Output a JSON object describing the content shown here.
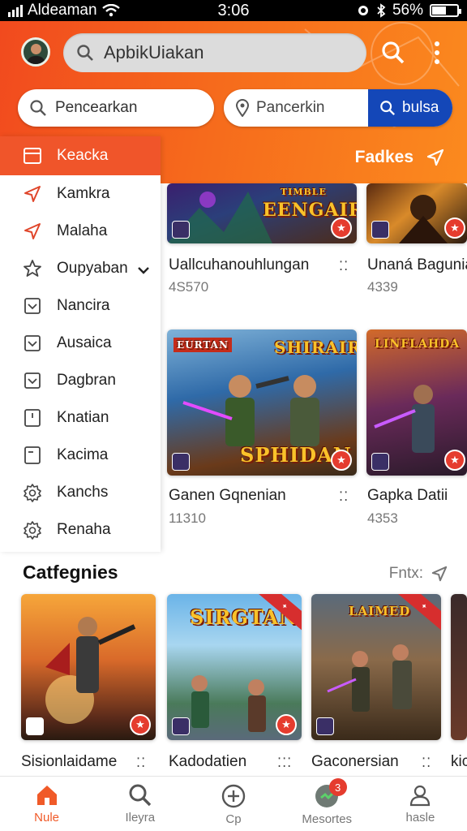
{
  "status_bar": {
    "carrier": "Aldeaman",
    "time": "3:06",
    "battery": "56%",
    "battery_level": 0.56
  },
  "header": {
    "search_text": "ApbikUiakan",
    "search_pill_left": "Pencearkan",
    "search_pill_mid": "Pancerkin",
    "search_pill_button": "bulsa",
    "fadkes_label": "Fadkes"
  },
  "sidebar": {
    "items": [
      {
        "label": "Keacka",
        "icon": "window-icon"
      },
      {
        "label": "Kamkra",
        "icon": "send-icon"
      },
      {
        "label": "Malaha",
        "icon": "send-icon"
      },
      {
        "label": "Oupyaban",
        "icon": "star-icon"
      },
      {
        "label": "Nancira",
        "icon": "checkbox-icon"
      },
      {
        "label": "Ausaica",
        "icon": "checkbox-icon"
      },
      {
        "label": "Dagbran",
        "icon": "checkbox-icon"
      },
      {
        "label": "Knatian",
        "icon": "bookmark-icon"
      },
      {
        "label": "Kacima",
        "icon": "bookmark-icon"
      },
      {
        "label": "Kanchs",
        "icon": "gear-icon"
      },
      {
        "label": "Renaha",
        "icon": "gear-icon"
      }
    ]
  },
  "games": [
    {
      "name": "Uallcuhanouhlungan",
      "count": "4S570",
      "art_title": "EENGAIRBA",
      "art_sub": "TIMBLE"
    },
    {
      "name": "Unaná Bagunia",
      "count": "4339"
    },
    {
      "name": "Ganen Gqnenian",
      "count": "11310",
      "art_title": "SPHIDAN",
      "art_sub": "SHIRAIRR",
      "art_tag": "EURTAN"
    },
    {
      "name": "Gapka Datii",
      "count": "4353",
      "art_title": "LINFLAHDA"
    }
  ],
  "categories": {
    "title": "Catfegnies",
    "more_label": "Fntx:",
    "items": [
      {
        "name": "Sisionlaidame"
      },
      {
        "name": "Kadodatien",
        "art_title": "SIRGTAN"
      },
      {
        "name": "Gaconersian",
        "art_title": "LAIMED"
      },
      {
        "name": "kic"
      }
    ]
  },
  "bottom_nav": {
    "items": [
      {
        "label": "Nule",
        "icon": "home-icon"
      },
      {
        "label": "Ileyra",
        "icon": "search-icon"
      },
      {
        "label": "Cp",
        "icon": "add-circle-icon"
      },
      {
        "label": "Mesortes",
        "icon": "messages-icon",
        "badge": "3"
      },
      {
        "label": "hasle",
        "icon": "profile-icon"
      }
    ]
  },
  "colors": {
    "accent": "#f05a28",
    "header_start": "#f14a1e",
    "header_end": "#fb8a1e",
    "button_blue": "#1447b8"
  }
}
